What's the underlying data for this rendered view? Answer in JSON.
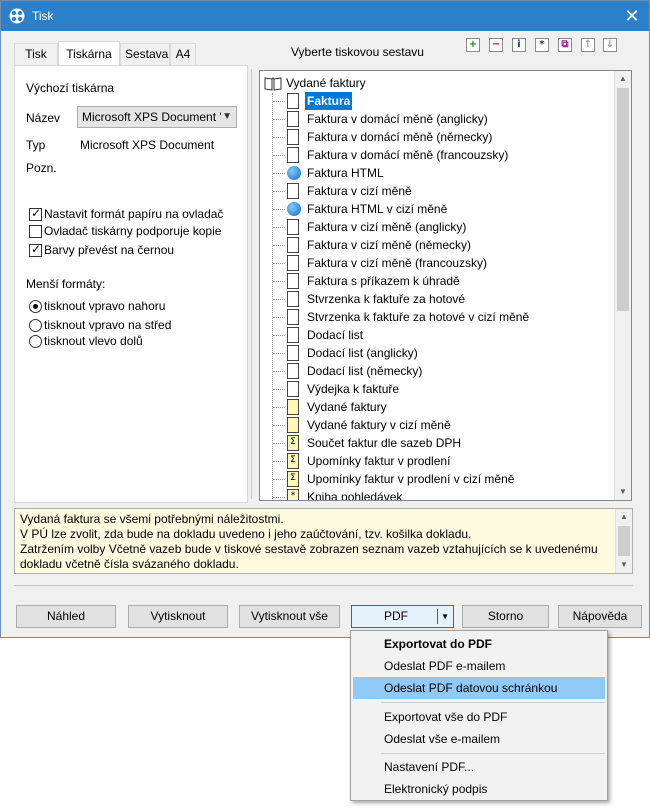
{
  "window": {
    "title": "Tisk",
    "close_glyph": "✕"
  },
  "tabs": [
    {
      "label": "Tisk"
    },
    {
      "label": "Tiskárna"
    },
    {
      "label": "Sestava"
    },
    {
      "label": "A4"
    }
  ],
  "printer": {
    "section_title": "Výchozí tiskárna",
    "name_label": "Název",
    "name_value": "Microsoft XPS Document '",
    "type_label": "Typ",
    "type_value": "Microsoft XPS Document",
    "note_label": "Pozn."
  },
  "options": [
    {
      "label": "Nastavit formát papíru na ovladač",
      "checked": true
    },
    {
      "label": "Ovladač tiskárny podporuje kopie",
      "checked": false
    },
    {
      "label": "Barvy převést na černou",
      "checked": true
    }
  ],
  "small_formats": {
    "title": "Menší formáty:",
    "choices": [
      {
        "label": "tisknout vpravo nahoru",
        "checked": true
      },
      {
        "label": "tisknout vpravo na střed",
        "checked": false
      },
      {
        "label": "tisknout vlevo dolů",
        "checked": false
      }
    ]
  },
  "report_sets": {
    "title": "Vyberte tiskovou sestavu",
    "toolbar": [
      {
        "icon": "add-icon",
        "glyph": "+",
        "color": "#1a8a1a"
      },
      {
        "icon": "remove-icon",
        "glyph": "−",
        "color": "#cc1111"
      },
      {
        "icon": "info-icon",
        "glyph": "i",
        "color": "#1c3d8f"
      },
      {
        "icon": "star-icon",
        "glyph": "*",
        "color": "#333333"
      },
      {
        "icon": "copy-icon",
        "glyph": "⧉",
        "color": "#9b1b9b"
      },
      {
        "icon": "move-up-icon",
        "glyph": "↑",
        "color": "#a0a0a0"
      },
      {
        "icon": "move-down-icon",
        "glyph": "↓",
        "color": "#a0a0a0"
      }
    ],
    "root": "Vydané faktury",
    "items": [
      {
        "label": "Faktura",
        "icon": "document-icon",
        "selected": true
      },
      {
        "label": "Faktura v domácí měně (anglicky)",
        "icon": "document-icon"
      },
      {
        "label": "Faktura v domácí měně (německy)",
        "icon": "document-icon"
      },
      {
        "label": "Faktura v domácí měně (francouzsky)",
        "icon": "document-icon"
      },
      {
        "label": "Faktura HTML",
        "icon": "globe-icon"
      },
      {
        "label": "Faktura v cizí měně",
        "icon": "document-icon"
      },
      {
        "label": "Faktura HTML v cizí měně",
        "icon": "globe-icon"
      },
      {
        "label": "Faktura v cizí měně (anglicky)",
        "icon": "document-icon"
      },
      {
        "label": "Faktura v cizí měně (německy)",
        "icon": "document-icon"
      },
      {
        "label": "Faktura v cizí měně (francouzsky)",
        "icon": "document-icon"
      },
      {
        "label": "Faktura s příkazem k úhradě",
        "icon": "document-icon"
      },
      {
        "label": "Stvrzenka k faktuře za hotové",
        "icon": "document-icon"
      },
      {
        "label": "Stvrzenka k faktuře za hotové v cizí měně",
        "icon": "document-icon"
      },
      {
        "label": "Dodací list",
        "icon": "document-icon"
      },
      {
        "label": "Dodací list (anglicky)",
        "icon": "document-icon"
      },
      {
        "label": "Dodací list (německy)",
        "icon": "document-icon"
      },
      {
        "label": "Výdejka k faktuře",
        "icon": "document-icon"
      },
      {
        "label": "Vydané faktury",
        "icon": "list-document-icon"
      },
      {
        "label": "Vydané faktury v cizí měně",
        "icon": "list-document-icon"
      },
      {
        "label": "Součet faktur dle sazeb DPH",
        "icon": "sum-document-icon"
      },
      {
        "label": "Upomínky faktur v prodlení",
        "icon": "sum-document-icon"
      },
      {
        "label": "Upomínky faktur v prodlení v cizí měně",
        "icon": "sum-document-icon"
      },
      {
        "label": "Kniha pohledávek",
        "icon": "star-document-icon"
      }
    ]
  },
  "description": {
    "lines": [
      "Vydaná faktura se všemi potřebnými náležitostmi.",
      "V PÚ lze zvolit, zda bude na dokladu uvedeno i jeho zaúčtování, tzv. košilka dokladu.",
      "Zatržením volby Včetně vazeb bude v tiskové sestavě zobrazen seznam vazeb vztahujících se k uvedenému",
      "dokladu včetně čísla svázaného dokladu."
    ]
  },
  "buttons": {
    "preview": "Náhled",
    "print": "Vytisknout",
    "print_all": "Vytisknout vše",
    "pdf": "PDF",
    "cancel": "Storno",
    "help": "Nápověda"
  },
  "pdf_menu": {
    "items": [
      {
        "label": "Exportovat do PDF",
        "bold": true
      },
      {
        "label": "Odeslat PDF e-mailem"
      },
      {
        "label": "Odeslat PDF datovou schránkou",
        "highlighted": true
      },
      {
        "label": "Exportovat vše do PDF"
      },
      {
        "label": "Odeslat vše e-mailem"
      },
      {
        "label": "Nastavení PDF..."
      },
      {
        "label": "Elektronický podpis"
      }
    ]
  },
  "colors": {
    "titlebar": "#2b80c9",
    "selection": "#0078d7",
    "menu_highlight": "#91c9f7",
    "description_bg": "#fefbe0"
  }
}
